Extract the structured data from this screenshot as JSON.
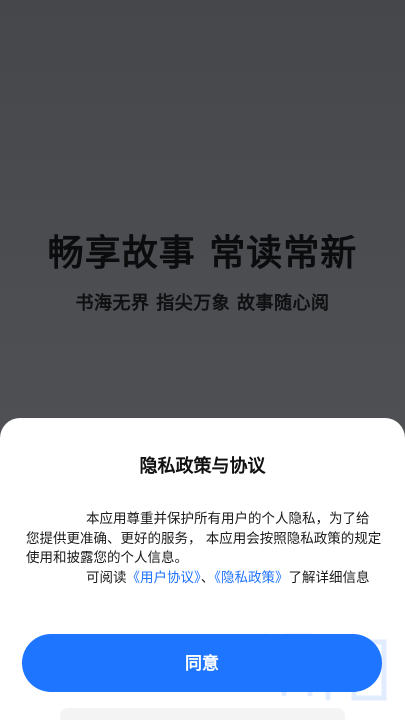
{
  "splash": {
    "slogan_main": "畅享故事  常读常新",
    "slogan_sub": "书海无界 指尖万象 故事随心阅"
  },
  "privacy_dialog": {
    "title": "隐私政策与协议",
    "paragraph_1": "本应用尊重并保护所有用户的个人隐私，为了给您提供更准确、更好的服务， 本应用会按照隐私政策的规定使用和披露您的个人信息。",
    "paragraph_2_prefix": "可阅读",
    "user_agreement_link": "《用户协议》",
    "separator": "、",
    "privacy_policy_link": "《隐私政策》",
    "paragraph_2_suffix": "了解详细信息",
    "agree_button": "同意"
  },
  "colors": {
    "accent": "#1e75ff",
    "link": "#1f73ff",
    "backdrop": "#4b4d51"
  }
}
